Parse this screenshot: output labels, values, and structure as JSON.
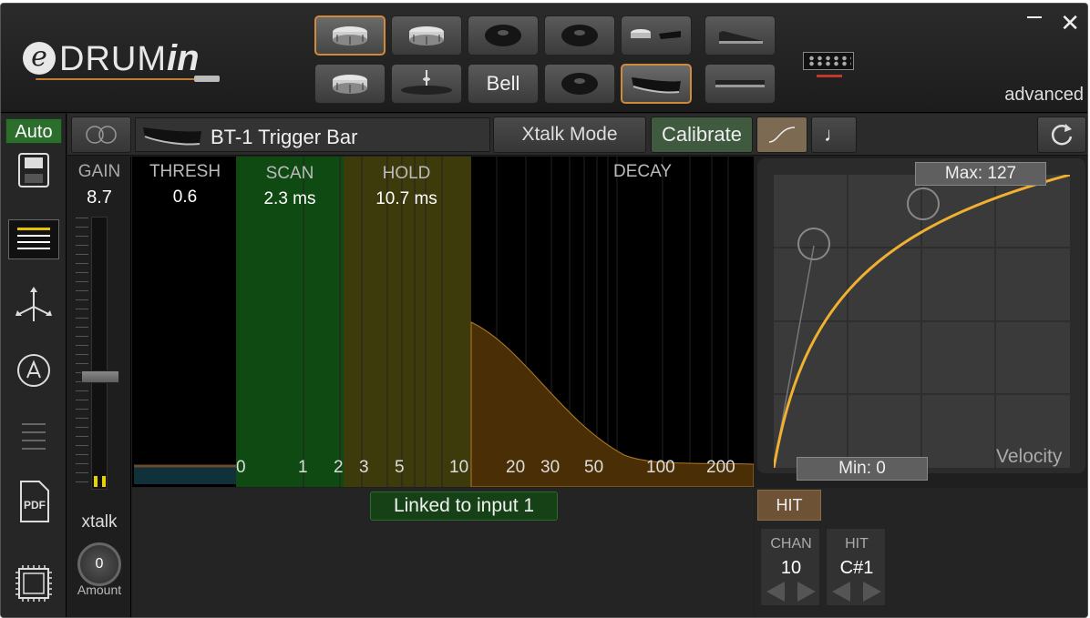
{
  "app": {
    "minimize_glyph": "—",
    "close_glyph": "✕",
    "mode_label": "advanced"
  },
  "logo": {
    "e": "e",
    "drum": "DRUM",
    "in": "in"
  },
  "pad_buttons": [
    {
      "icon": "drum-pad-icon",
      "selected": true
    },
    {
      "icon": "drum-pad-icon",
      "selected": false
    },
    {
      "icon": "cymbal-icon",
      "selected": false
    },
    {
      "icon": "cymbal-icon",
      "selected": false
    },
    {
      "icon": "drum-and-bar-icon",
      "selected": false
    },
    {
      "icon": "hihat-pedal-icon",
      "selected": false
    },
    {
      "icon": "drum-pad-icon",
      "selected": false
    },
    {
      "icon": "hihat-icon",
      "selected": false
    },
    {
      "label": "Bell",
      "selected": false
    },
    {
      "icon": "cymbal-icon",
      "selected": false
    },
    {
      "icon": "trigger-bar-icon",
      "selected": true
    },
    {
      "icon": "bar-pad-icon",
      "selected": false
    }
  ],
  "left_toolbar": {
    "auto_label": "Auto",
    "xtalk_label": "xtalk",
    "amount_value": "0",
    "amount_label": "Amount"
  },
  "header": {
    "pad_name": "BT-1 Trigger Bar",
    "xtalk_mode": "Xtalk Mode",
    "calibrate": "Calibrate",
    "note_glyph": "♩"
  },
  "gain": {
    "label": "GAIN",
    "value": "8.7"
  },
  "params": {
    "thresh": {
      "label": "THRESH",
      "value": "0.6"
    },
    "scan": {
      "label": "SCAN",
      "value": "2.3 ms"
    },
    "hold": {
      "label": "HOLD",
      "value": "10.7 ms"
    },
    "decay": {
      "label": "DECAY"
    }
  },
  "time_axis": [
    "0",
    "1",
    "2",
    "3",
    "5",
    "10",
    "20",
    "30",
    "50",
    "100",
    "200"
  ],
  "curve": {
    "max_label": "Max: 127",
    "min_label": "Min: 0",
    "axis_label": "Velocity"
  },
  "status": {
    "linked": "Linked to input 1"
  },
  "midi": {
    "hit_button": "HIT",
    "chan_header": "CHAN",
    "chan_value": "10",
    "note_header": "HIT",
    "note_value": "C#1"
  }
}
